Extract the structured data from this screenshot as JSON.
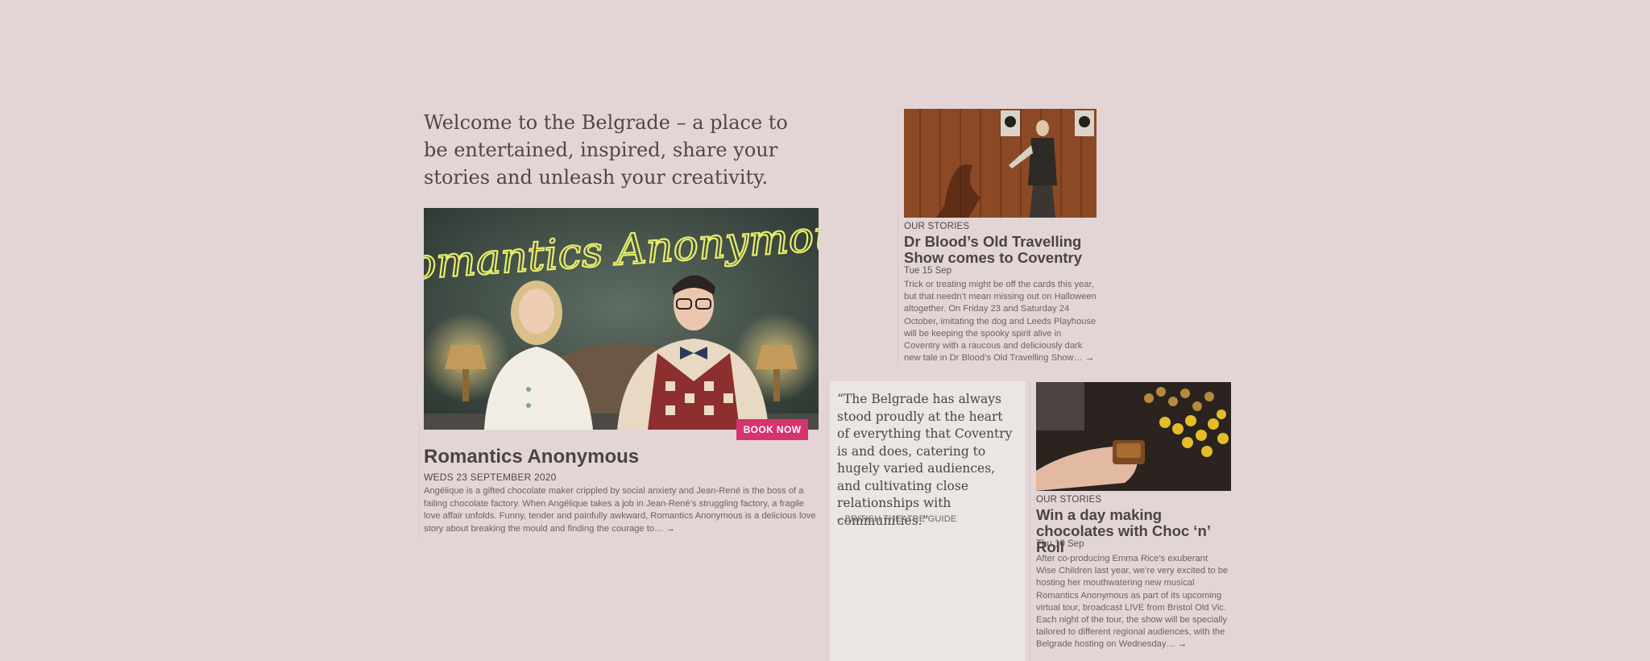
{
  "intro": {
    "heading": "Welcome to the Belgrade – a place to be entertained, inspired, share your stories and unleash your creativity."
  },
  "hero": {
    "sign_text": "Romantics Anonymous",
    "book_label": "BOOK NOW",
    "title": "Romantics Anonymous",
    "date": "WEDS 23 SEPTEMBER 2020",
    "description": "Angélique is a gifted chocolate maker crippled by social anxiety and Jean-René is the boss of a failing chocolate factory. When Angélique takes a job in Jean-René’s struggling factory, a fragile love affair unfolds. Funny, tender and painfully awkward, Romantics Anonymous is a delicious love story about breaking the mould and finding the courage to…",
    "more": "→"
  },
  "story1": {
    "category": "OUR STORIES",
    "title": "Dr Blood’s Old Travelling Show comes to Coventry",
    "date": "Tue 15 Sep",
    "description": "Trick or treating might be off the cards this year, but that needn’t mean missing out on Halloween altogether. On Friday 23 and Saturday 24 October, imitating the dog and Leeds Playhouse will be keeping the spooky spirit alive in Coventry with a raucous and deliciously dark new tale in Dr Blood’s Old Travelling Show…",
    "more": "→"
  },
  "quote": {
    "text": "“The Belgrade has always stood proudly at the heart of everything that Coventry is and does, catering to hugely varied audiences, and cultivating close relationships with communities.”",
    "source": "– BRITISH THEATRE GUIDE"
  },
  "story2": {
    "category": "OUR STORIES",
    "title": "Win a day making chocolates with Choc ‘n’ Roll",
    "date": "Thu 10 Sep",
    "description": "After co-producing Emma Rice’s exuberant Wise Children last year, we’re very excited to be hosting her mouthwatering new musical Romantics Anonymous as part of its upcoming virtual tour, broadcast LIVE from Bristol Old Vic. Each night of the tour, the show will be specially tailored to different regional audiences, with the Belgrade hosting on Wednesday…",
    "more": "→"
  },
  "colors": {
    "background": "#e3d5d6",
    "accent": "#d6336f",
    "quote_card": "#ebe5e4"
  }
}
